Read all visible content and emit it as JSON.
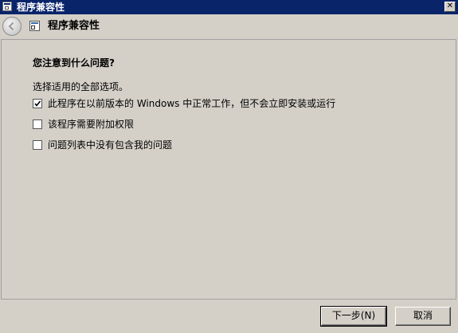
{
  "window": {
    "title": "程序兼容性",
    "close_glyph": "✕"
  },
  "nav": {
    "title": "程序兼容性"
  },
  "content": {
    "question": "您注意到什么问题?",
    "instruction": "选择适用的全部选项。",
    "options": [
      {
        "label": "此程序在以前版本的 Windows 中正常工作，但不会立即安装或运行",
        "checked": true
      },
      {
        "label": "该程序需要附加权限",
        "checked": false
      },
      {
        "label": "问题列表中没有包含我的问题",
        "checked": false
      }
    ]
  },
  "buttons": {
    "next": "下一步(N)",
    "cancel": "取消"
  }
}
